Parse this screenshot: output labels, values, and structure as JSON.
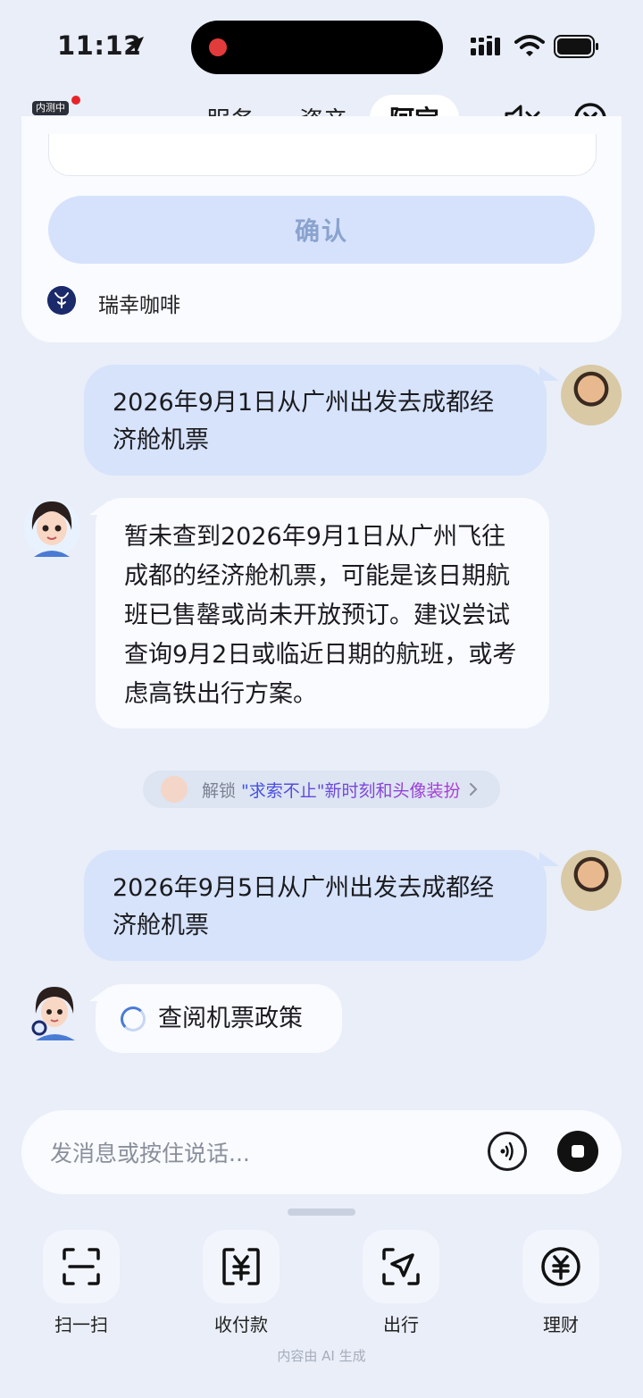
{
  "status_bar": {
    "time": "11:12"
  },
  "nav": {
    "badge": "内测中",
    "tabs": [
      {
        "label": "服务",
        "active": false
      },
      {
        "label": "资产",
        "active": false
      },
      {
        "label": "阿宝",
        "active": true
      }
    ]
  },
  "card": {
    "confirm_label": "确认",
    "merchant_name": "瑞幸咖啡"
  },
  "messages": [
    {
      "role": "user",
      "text": "2026年9月1日从广州出发去成都经济舱机票"
    },
    {
      "role": "assistant",
      "text": "暂未查到2026年9月1日从广州飞往成都的经济舱机票，可能是该日期航班已售罄或尚未开放预订。建议尝试查询9月2日或临近日期的航班，或考虑高铁出行方案。"
    },
    {
      "role": "user",
      "text": "2026年9月5日从广州出发去成都经济舱机票"
    },
    {
      "role": "assistant",
      "text": "查阅机票政策",
      "loading": true
    }
  ],
  "unlock_banner": {
    "prefix": "解锁",
    "highlight": "\"求索不止\"新时刻和头像装扮"
  },
  "input": {
    "placeholder": "发消息或按住说话..."
  },
  "shortcuts": [
    {
      "label": "扫一扫",
      "icon": "scan-icon"
    },
    {
      "label": "收付款",
      "icon": "payment-icon"
    },
    {
      "label": "出行",
      "icon": "travel-icon"
    },
    {
      "label": "理财",
      "icon": "wealth-icon"
    }
  ],
  "footer_note": "内容由 AI 生成",
  "colors": {
    "background": "#e9eef8",
    "user_bubble": "#d6e3fb",
    "assistant_bubble": "#f9fbff",
    "confirm_button": "#d6e2fb",
    "accent_blue": "#4b7bd6"
  }
}
